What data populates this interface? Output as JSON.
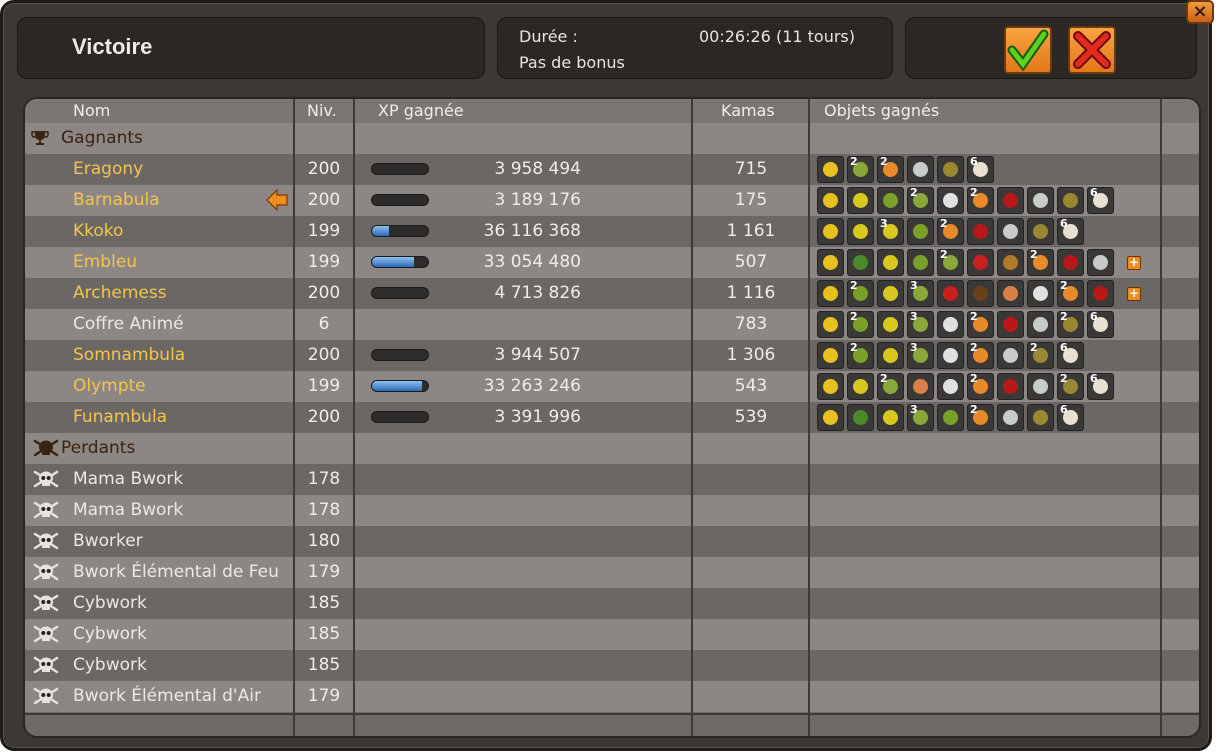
{
  "window": {
    "close_glyph": "×",
    "title": "Victoire",
    "duration_label": "Durée :",
    "duration_value": "00:26:26 (11 tours)",
    "bonus": "Pas de bonus",
    "buttons": [
      {
        "name": "validate-button",
        "icon": "green-check-icon"
      },
      {
        "name": "cancel-button",
        "icon": "red-x-icon"
      }
    ]
  },
  "columns": {
    "name": "Nom",
    "level": "Niv.",
    "xp": "XP gagnée",
    "kamas": "Kamas",
    "items": "Objets gagnés"
  },
  "groups": {
    "winners": {
      "label": "Gagnants",
      "icon": "trophy-icon"
    },
    "losers": {
      "label": "Perdants",
      "icon": "skull-icon"
    }
  },
  "colors": {
    "winner_name": "#f5c44e",
    "accent_orange": "#f08b1c",
    "xp_fill": "#2a6ab6"
  },
  "winners": [
    {
      "name": "Eragony",
      "level": "200",
      "xp_progress": 0.0,
      "xp": "3 958 494",
      "kamas": "715",
      "items": [
        {
          "icon": "gold-medal-icon",
          "c": "#e8c020"
        },
        {
          "icon": "leaf-pouch-icon",
          "c": "#8aa838",
          "qty": "2"
        },
        {
          "icon": "orange-claw-icon",
          "c": "#e88a2a",
          "qty": "2"
        },
        {
          "icon": "feather-icon",
          "c": "#c8ccc8"
        },
        {
          "icon": "hide-icon",
          "c": "#9a8830"
        },
        {
          "icon": "skull-trophy-icon",
          "c": "#e8e0d0",
          "qty": "6"
        }
      ]
    },
    {
      "name": "Barnabula",
      "level": "200",
      "xp_progress": 0.0,
      "xp": "3 189 176",
      "kamas": "175",
      "current": true,
      "items": [
        {
          "icon": "gold-medal-icon",
          "c": "#e8c020"
        },
        {
          "icon": "yellow-wing-icon",
          "c": "#d8c820"
        },
        {
          "icon": "green-fruit-icon",
          "c": "#7aa028"
        },
        {
          "icon": "leaf-pouch-icon",
          "c": "#8aa838",
          "qty": "2"
        },
        {
          "icon": "white-bandage-icon",
          "c": "#e0e0e0"
        },
        {
          "icon": "orange-claw-icon",
          "c": "#e88a2a",
          "qty": "2"
        },
        {
          "icon": "red-scarf-icon",
          "c": "#b81818"
        },
        {
          "icon": "feather-icon",
          "c": "#c8ccc8"
        },
        {
          "icon": "hide-icon",
          "c": "#9a8830"
        },
        {
          "icon": "skull-trophy-icon",
          "c": "#e8e0d0",
          "qty": "6"
        }
      ]
    },
    {
      "name": "Kkoko",
      "level": "199",
      "xp_progress": 0.3,
      "xp": "36 116 368",
      "kamas": "1 161",
      "items": [
        {
          "icon": "gold-medal-icon",
          "c": "#e8c020"
        },
        {
          "icon": "yellow-wing-icon",
          "c": "#d8c820"
        },
        {
          "icon": "yellow-wing-icon",
          "c": "#d8c820",
          "qty": "3"
        },
        {
          "icon": "green-fruit-icon",
          "c": "#7aa028"
        },
        {
          "icon": "orange-claw-icon",
          "c": "#e88a2a",
          "qty": "2"
        },
        {
          "icon": "red-scarf-icon",
          "c": "#b81818"
        },
        {
          "icon": "feather-icon",
          "c": "#c8ccc8"
        },
        {
          "icon": "hide-icon",
          "c": "#9a8830"
        },
        {
          "icon": "skull-trophy-icon",
          "c": "#e8e0d0",
          "qty": "6"
        }
      ]
    },
    {
      "name": "Embleu",
      "level": "199",
      "xp_progress": 0.75,
      "xp": "33 054 480",
      "kamas": "507",
      "more": true,
      "items": [
        {
          "icon": "gold-medal-icon",
          "c": "#e8c020"
        },
        {
          "icon": "green-leaf-icon",
          "c": "#4a8a28"
        },
        {
          "icon": "yellow-wing-icon",
          "c": "#d8c820"
        },
        {
          "icon": "green-fruit-icon",
          "c": "#7aa028"
        },
        {
          "icon": "leaf-pouch-icon",
          "c": "#8aa838",
          "qty": "2"
        },
        {
          "icon": "red-pants-icon",
          "c": "#c82020"
        },
        {
          "icon": "leather-belt-icon",
          "c": "#b07a28"
        },
        {
          "icon": "orange-claw-icon",
          "c": "#e88a2a",
          "qty": "2"
        },
        {
          "icon": "red-scarf-icon",
          "c": "#b81818"
        },
        {
          "icon": "feather-icon",
          "c": "#c8ccc8"
        }
      ]
    },
    {
      "name": "Archemess",
      "level": "200",
      "xp_progress": 0.0,
      "xp": "4 713 826",
      "kamas": "1 116",
      "more": true,
      "items": [
        {
          "icon": "gold-medal-icon",
          "c": "#e8c020"
        },
        {
          "icon": "green-fruit-icon",
          "c": "#7aa028",
          "qty": "2"
        },
        {
          "icon": "yellow-wing-icon",
          "c": "#d8c820"
        },
        {
          "icon": "leaf-pouch-icon",
          "c": "#8aa838",
          "qty": "3"
        },
        {
          "icon": "red-pants-icon",
          "c": "#c82020"
        },
        {
          "icon": "brown-antler-icon",
          "c": "#6a4018"
        },
        {
          "icon": "candy-icon",
          "c": "#d88048"
        },
        {
          "icon": "white-bandage-icon",
          "c": "#e0e0e0"
        },
        {
          "icon": "orange-claw-icon",
          "c": "#e88a2a",
          "qty": "2"
        },
        {
          "icon": "red-scarf-icon",
          "c": "#b81818"
        }
      ]
    },
    {
      "name": "Coffre Animé",
      "level": "6",
      "xp_progress": null,
      "xp": "",
      "kamas": "783",
      "neutral": true,
      "items": [
        {
          "icon": "gold-medal-icon",
          "c": "#e8c020"
        },
        {
          "icon": "green-fruit-icon",
          "c": "#7aa028",
          "qty": "2"
        },
        {
          "icon": "yellow-wing-icon",
          "c": "#d8c820"
        },
        {
          "icon": "leaf-pouch-icon",
          "c": "#8aa838",
          "qty": "3"
        },
        {
          "icon": "white-bandage-icon",
          "c": "#e0e0e0"
        },
        {
          "icon": "orange-claw-icon",
          "c": "#e88a2a",
          "qty": "2"
        },
        {
          "icon": "red-scarf-icon",
          "c": "#b81818"
        },
        {
          "icon": "feather-icon",
          "c": "#c8ccc8"
        },
        {
          "icon": "hide-icon",
          "c": "#9a8830",
          "qty": "2"
        },
        {
          "icon": "skull-trophy-icon",
          "c": "#e8e0d0",
          "qty": "6"
        }
      ]
    },
    {
      "name": "Somnambula",
      "level": "200",
      "xp_progress": 0.0,
      "xp": "3 944 507",
      "kamas": "1 306",
      "items": [
        {
          "icon": "gold-medal-icon",
          "c": "#e8c020"
        },
        {
          "icon": "green-fruit-icon",
          "c": "#7aa028",
          "qty": "2"
        },
        {
          "icon": "yellow-wing-icon",
          "c": "#d8c820"
        },
        {
          "icon": "leaf-pouch-icon",
          "c": "#8aa838",
          "qty": "3"
        },
        {
          "icon": "white-bandage-icon",
          "c": "#e0e0e0"
        },
        {
          "icon": "orange-claw-icon",
          "c": "#e88a2a",
          "qty": "2"
        },
        {
          "icon": "feather-icon",
          "c": "#c8ccc8"
        },
        {
          "icon": "hide-icon",
          "c": "#9a8830",
          "qty": "2"
        },
        {
          "icon": "skull-trophy-icon",
          "c": "#e8e0d0",
          "qty": "6"
        }
      ]
    },
    {
      "name": "Olympte",
      "level": "199",
      "xp_progress": 0.9,
      "xp": "33 263 246",
      "kamas": "543",
      "items": [
        {
          "icon": "gold-medal-icon",
          "c": "#e8c020"
        },
        {
          "icon": "yellow-wing-icon",
          "c": "#d8c820"
        },
        {
          "icon": "leaf-pouch-icon",
          "c": "#8aa838",
          "qty": "2"
        },
        {
          "icon": "candy-icon",
          "c": "#d88048"
        },
        {
          "icon": "white-bandage-icon",
          "c": "#e0e0e0"
        },
        {
          "icon": "orange-claw-icon",
          "c": "#e88a2a",
          "qty": "2"
        },
        {
          "icon": "red-scarf-icon",
          "c": "#b81818"
        },
        {
          "icon": "feather-icon",
          "c": "#c8ccc8"
        },
        {
          "icon": "hide-icon",
          "c": "#9a8830",
          "qty": "2"
        },
        {
          "icon": "skull-trophy-icon",
          "c": "#e8e0d0",
          "qty": "6"
        }
      ]
    },
    {
      "name": "Funambula",
      "level": "200",
      "xp_progress": 0.0,
      "xp": "3 391 996",
      "kamas": "539",
      "items": [
        {
          "icon": "gold-medal-icon",
          "c": "#e8c020"
        },
        {
          "icon": "green-leaf-icon",
          "c": "#4a8a28"
        },
        {
          "icon": "yellow-wing-icon",
          "c": "#d8c820"
        },
        {
          "icon": "leaf-pouch-icon",
          "c": "#8aa838",
          "qty": "3"
        },
        {
          "icon": "green-fruit-icon",
          "c": "#7aa028"
        },
        {
          "icon": "orange-claw-icon",
          "c": "#e88a2a",
          "qty": "2"
        },
        {
          "icon": "feather-icon",
          "c": "#c8ccc8"
        },
        {
          "icon": "hide-icon",
          "c": "#9a8830"
        },
        {
          "icon": "skull-trophy-icon",
          "c": "#e8e0d0",
          "qty": "6"
        }
      ]
    }
  ],
  "losers": [
    {
      "name": "Mama Bwork",
      "level": "178"
    },
    {
      "name": "Mama Bwork",
      "level": "178"
    },
    {
      "name": "Bworker",
      "level": "180"
    },
    {
      "name": "Bwork Élémental de Feu",
      "level": "179"
    },
    {
      "name": "Cybwork",
      "level": "185"
    },
    {
      "name": "Cybwork",
      "level": "185"
    },
    {
      "name": "Cybwork",
      "level": "185"
    },
    {
      "name": "Bwork Élémental d'Air",
      "level": "179"
    }
  ]
}
